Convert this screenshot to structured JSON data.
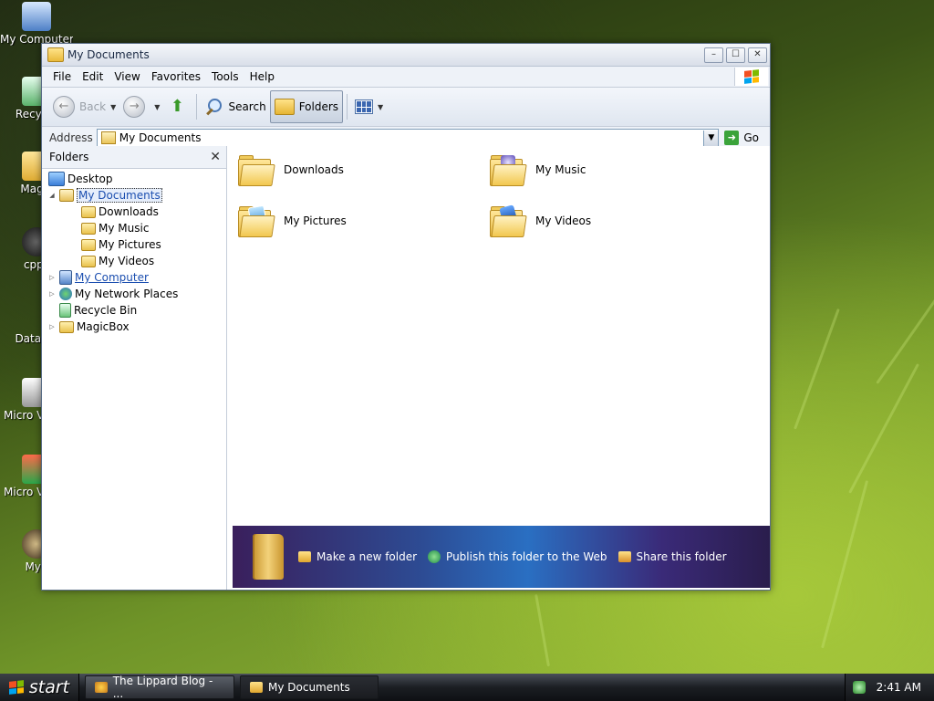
{
  "desktop": {
    "icons": [
      {
        "label": "My Computer"
      },
      {
        "label": "Recycle"
      },
      {
        "label": "Magic"
      },
      {
        "label": "cpps"
      },
      {
        "label": "DataWa"
      },
      {
        "label": "Micro Visual"
      },
      {
        "label": "Micro Visual"
      },
      {
        "label": "Myp"
      }
    ]
  },
  "window": {
    "title": "My Documents",
    "menu": [
      "File",
      "Edit",
      "View",
      "Favorites",
      "Tools",
      "Help"
    ],
    "toolbar": {
      "back_label": "Back",
      "search_label": "Search",
      "folders_label": "Folders"
    },
    "address": {
      "label": "Address",
      "value": "My Documents",
      "go_label": "Go"
    },
    "folders_pane": {
      "title": "Folders",
      "tree": [
        {
          "label": "Desktop"
        },
        {
          "label": "My Documents"
        },
        {
          "label": "Downloads"
        },
        {
          "label": "My Music"
        },
        {
          "label": "My Pictures"
        },
        {
          "label": "My Videos"
        },
        {
          "label": "My Computer"
        },
        {
          "label": "My Network Places"
        },
        {
          "label": "Recycle Bin"
        },
        {
          "label": "MagicBox"
        }
      ]
    },
    "items": [
      {
        "label": "Downloads"
      },
      {
        "label": "My Music"
      },
      {
        "label": "My Pictures"
      },
      {
        "label": "My Videos"
      }
    ],
    "tasks": {
      "new_folder": "Make a new folder",
      "publish": "Publish this folder to the Web",
      "share": "Share this folder"
    }
  },
  "taskbar": {
    "start_label": "start",
    "tasks": [
      {
        "label": "The Lippard Blog - ..."
      },
      {
        "label": "My Documents"
      }
    ],
    "clock": "2:41 AM"
  }
}
